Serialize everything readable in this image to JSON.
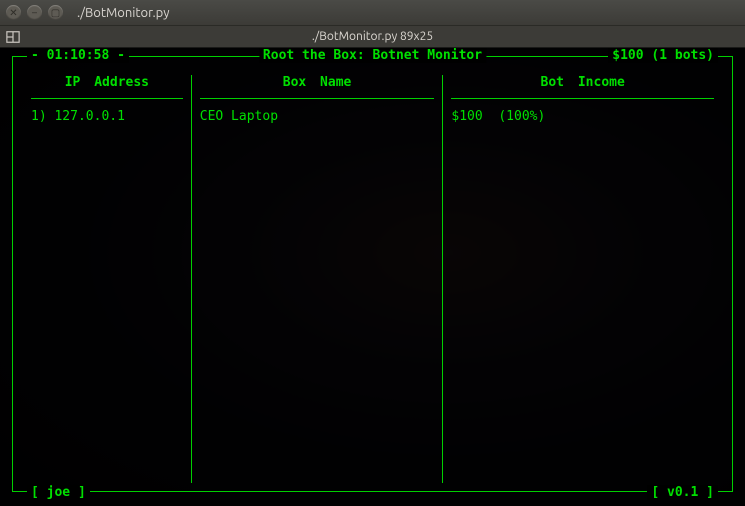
{
  "window": {
    "title": "./BotMonitor.py",
    "subtitle": "./BotMonitor.py 89x25"
  },
  "app": {
    "title": "Root the Box: Botnet Monitor",
    "timestamp": "- 01:10:58 -",
    "summary": "$100 (1 bots)",
    "user_label": "[ joe ]",
    "version_label": "[ v0.1 ]"
  },
  "columns": {
    "ip": {
      "header": "IP  Address"
    },
    "box": {
      "header": "Box  Name"
    },
    "income": {
      "header": "Bot  Income"
    }
  },
  "rows": [
    {
      "index": "1)",
      "ip": "127.0.0.1",
      "box": "CEO Laptop",
      "income": "$100  (100%)"
    }
  ],
  "colors": {
    "accent": "#00e000"
  }
}
